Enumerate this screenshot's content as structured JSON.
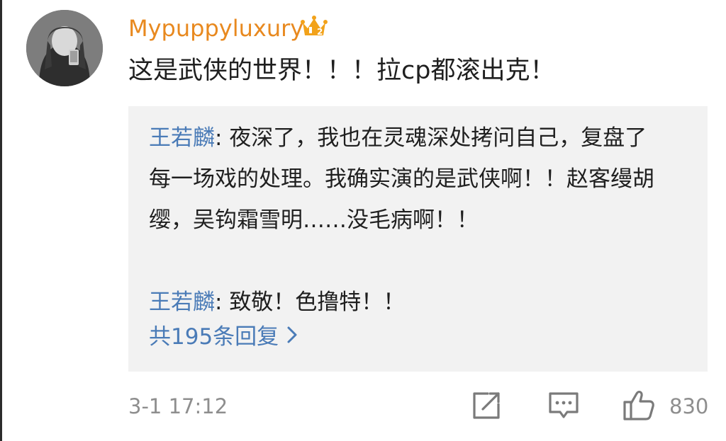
{
  "comment": {
    "username": "Mypuppyluxury",
    "badge_icon": "vip-crown-icon",
    "text": "这是武侠的世界！！！拉cp都滚出克！",
    "timestamp": "3-1 17:12"
  },
  "replies": [
    {
      "author": "王若麟",
      "separator": ": ",
      "text": "夜深了，我也在灵魂深处拷问自己，复盘了每一场戏的处理。我确实演的是武侠啊！！赵客缦胡缨，吴钩霜雪明……没毛病啊！！"
    },
    {
      "author": "王若麟",
      "separator": ": ",
      "text": "致敬！色撸特！！"
    }
  ],
  "more_replies": {
    "label": "共195条回复",
    "icon": "chevron-right-icon"
  },
  "actions": {
    "share_icon": "share-icon",
    "comment_icon": "comment-icon",
    "like_icon": "thumbs-up-icon",
    "like_count": "830"
  },
  "colors": {
    "username": "#e8891f",
    "link": "#4a7bb7",
    "text": "#1f1f1f",
    "muted": "#8e8e8e",
    "reply_bg": "#f2f2f2"
  }
}
